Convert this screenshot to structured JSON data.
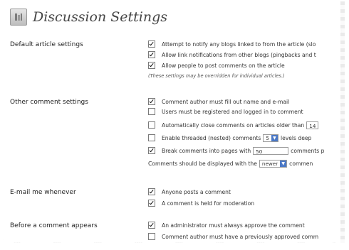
{
  "page": {
    "title": "Discussion Settings",
    "icon": "settings-icon"
  },
  "sections": {
    "default_article": {
      "label": "Default article settings",
      "options": [
        {
          "label": "Attempt to notify any blogs linked to from the article (slo",
          "checked": true
        },
        {
          "label": "Allow link notifications from other blogs (pingbacks and t",
          "checked": true
        },
        {
          "label": "Allow people to post comments on the article",
          "checked": true
        }
      ],
      "note": "(These settings may be overridden for individual articles.)"
    },
    "other_comment": {
      "label": "Other comment settings",
      "options": [
        {
          "label": "Comment author must fill out name and e-mail",
          "checked": true
        },
        {
          "label": "Users must be registered and logged in to comment",
          "checked": false
        }
      ],
      "auto_close": {
        "label": "Automatically close comments on articles older than",
        "value": "14",
        "checked": false
      },
      "threaded": {
        "label": "Enable threaded (nested) comments",
        "value": "5",
        "suffix": "levels deep",
        "checked": false
      },
      "paging": {
        "label": "Break comments into pages with",
        "value": "50",
        "suffix": "comments p",
        "checked": true
      },
      "display_order": {
        "label": "Comments should be displayed with the",
        "value": "newer",
        "suffix": "commen"
      }
    },
    "email_me": {
      "label": "E-mail me whenever",
      "options": [
        {
          "label": "Anyone posts a comment",
          "checked": true
        },
        {
          "label": "A comment is held for moderation",
          "checked": true
        }
      ]
    },
    "before_comment": {
      "label": "Before a comment appears",
      "options": [
        {
          "label": "An administrator must always approve the comment",
          "checked": true
        },
        {
          "label": "Comment author must have a previously approved comm",
          "checked": false
        }
      ]
    }
  }
}
